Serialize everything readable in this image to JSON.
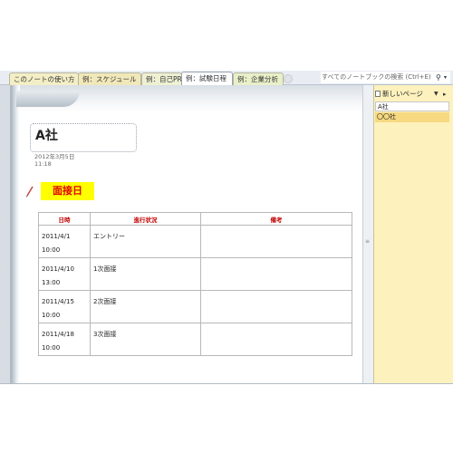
{
  "tabs": [
    {
      "label": "このノートの使い方"
    },
    {
      "label": "例：スケジュール"
    },
    {
      "label": "例：自己PR"
    },
    {
      "label": "例：試験日程"
    },
    {
      "label": "例：企業分析"
    }
  ],
  "search": {
    "placeholder": "すべてのノートブックの検索 (Ctrl+E)"
  },
  "page": {
    "title": "A社",
    "date": "2012年3月5日",
    "time": "11:18",
    "heading": "面接日"
  },
  "table": {
    "headers": [
      "日時",
      "進行状況",
      "備考"
    ],
    "rows": [
      {
        "date": "2011/4/1",
        "time": "10:00",
        "status": "エントリー",
        "note": ""
      },
      {
        "date": "2011/4/10",
        "time": "13:00",
        "status": "1次面接",
        "note": ""
      },
      {
        "date": "2011/4/15",
        "time": "10:00",
        "status": "2次面接",
        "note": ""
      },
      {
        "date": "2011/4/18",
        "time": "10:00",
        "status": "3次面接",
        "note": ""
      }
    ]
  },
  "sidebar": {
    "new_page": "新しいページ",
    "pages": [
      {
        "label": "A社"
      },
      {
        "label": "〇〇社"
      }
    ]
  },
  "colors": {
    "heading_highlight": "#ffff00",
    "heading_text": "#e00000",
    "table_header_text": "#c00000",
    "page_list_bg": "#fdf2be",
    "selected_page_bg": "#f6d980"
  },
  "icons": [
    "search-icon",
    "pen-icon",
    "new-page-icon",
    "add-tab-icon"
  ]
}
